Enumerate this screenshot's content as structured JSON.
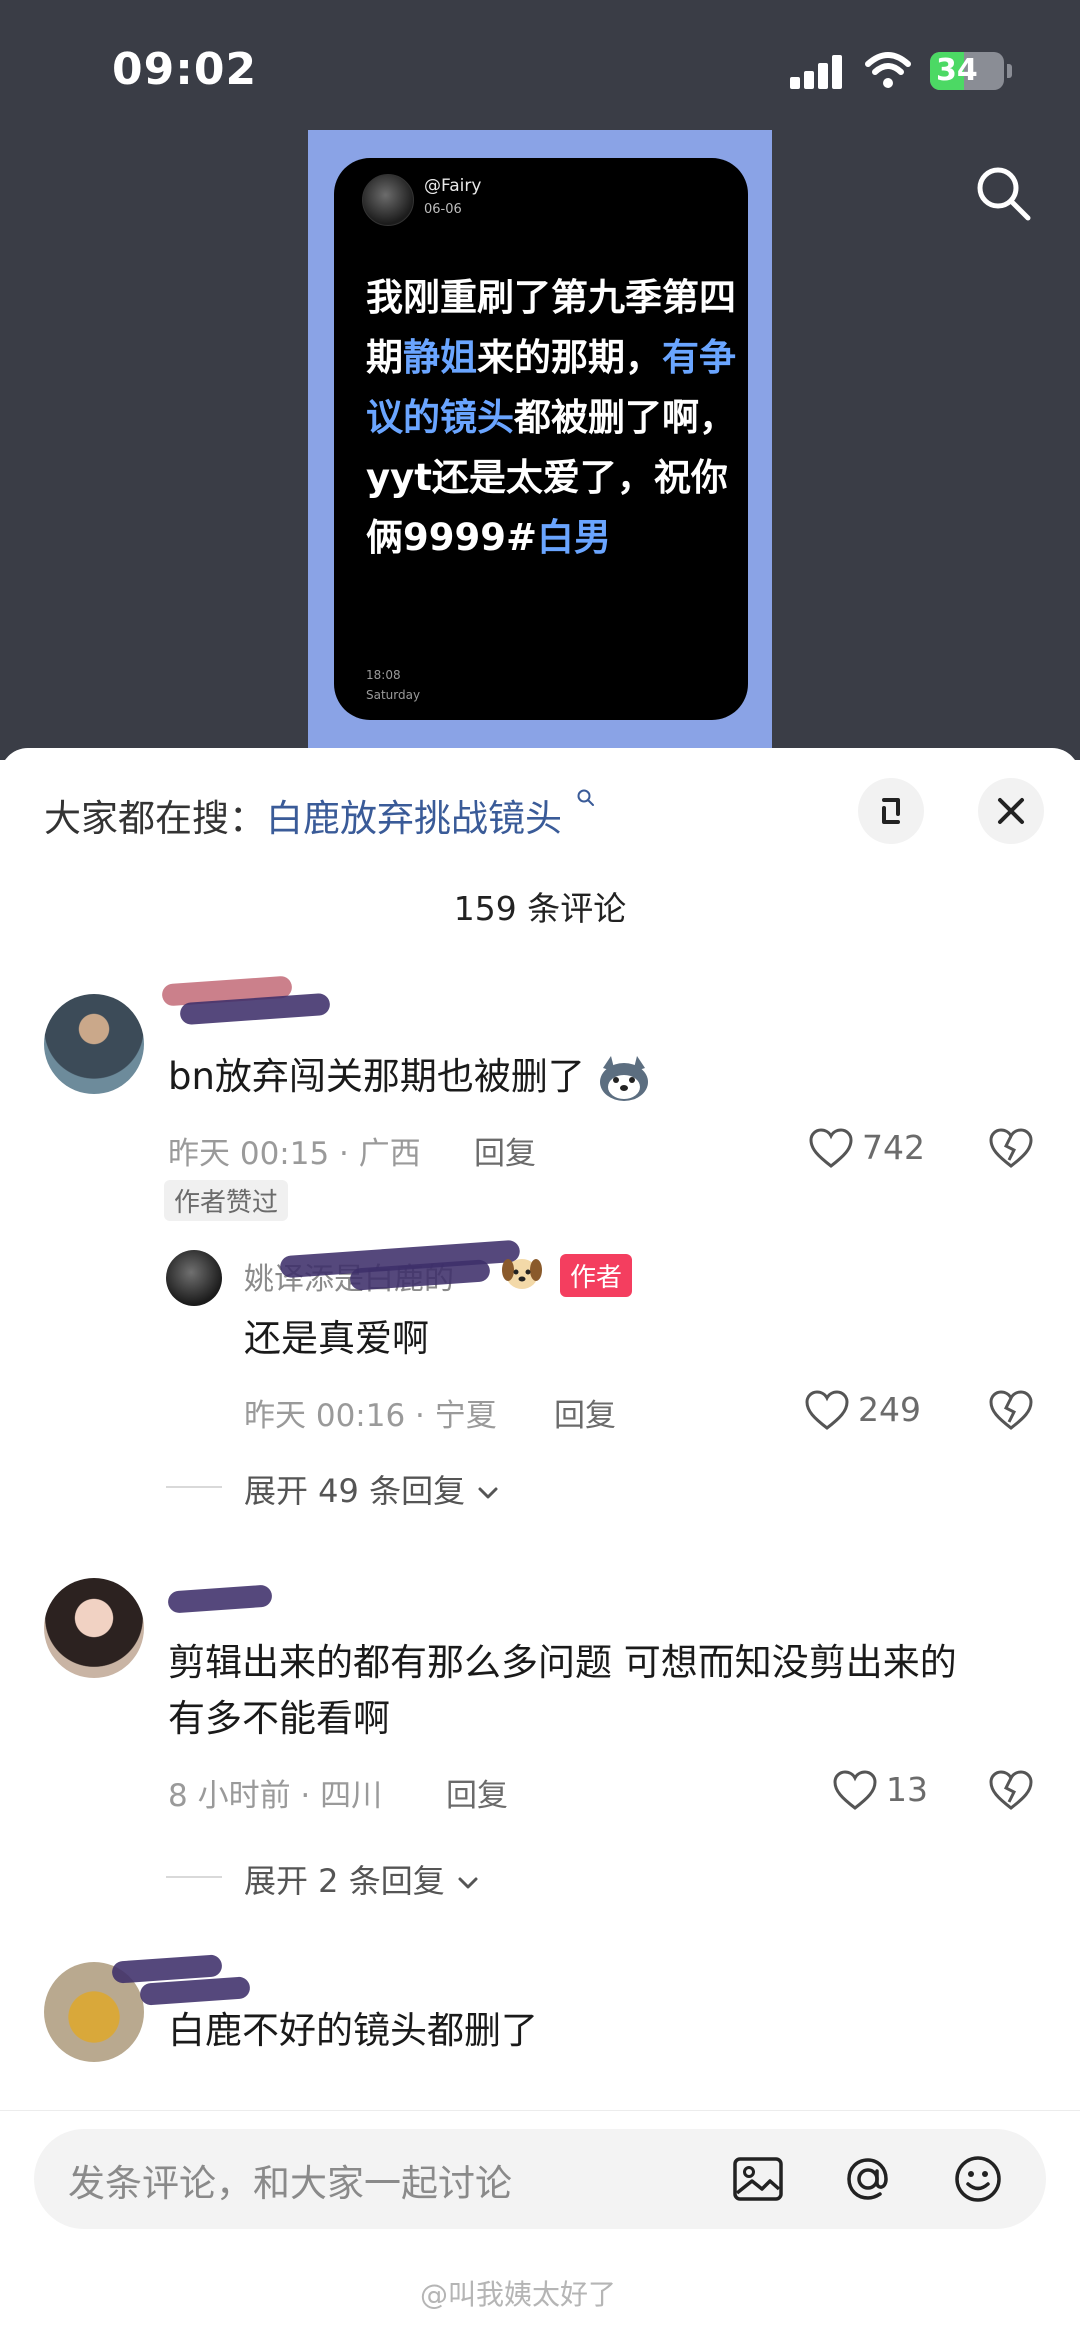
{
  "status": {
    "time": "09:02",
    "battery": "34"
  },
  "post_card": {
    "user": "@Fairy",
    "date": "06-06",
    "text_parts": [
      {
        "t": "我刚重刷了第九季第四期",
        "hl": false
      },
      {
        "t": "静姐",
        "hl": true
      },
      {
        "t": "来的那期，",
        "hl": false
      },
      {
        "t": "有争议的镜头",
        "hl": true
      },
      {
        "t": "都被删了啊，yyt还是太爱了，祝你俩9999#",
        "hl": false
      },
      {
        "t": "白男",
        "hl": true
      }
    ],
    "time": "18:08",
    "day": "Saturday"
  },
  "sheet": {
    "hot_search_label": "大家都在搜：",
    "hot_search_query": "白鹿放弃挑战镜头",
    "comment_count": "159 条评论"
  },
  "comments": {
    "c1": {
      "text": "bn放弃闯关那期也被删了",
      "meta": "昨天 00:15 · 广西",
      "reply": "回复",
      "likes": "742",
      "badge": "作者赞过"
    },
    "r1": {
      "username": "姚译添是白鹿的",
      "author_tag": "作者",
      "text": "还是真爱啊",
      "meta": "昨天 00:16 · 宁夏",
      "reply": "回复",
      "likes": "249"
    },
    "expand1": "展开 49 条回复",
    "c2": {
      "text_line1": "剪辑出来的都有那么多问题 可想而知没剪出来的",
      "text_line2": "有多不能看啊",
      "meta": "8 小时前 · 四川",
      "reply": "回复",
      "likes": "13"
    },
    "expand2": "展开 2 条回复",
    "c3": {
      "text": "白鹿不好的镜头都删了"
    }
  },
  "input": {
    "placeholder": "发条评论，和大家一起讨论"
  },
  "watermark": "@叫我姨太好了",
  "colors": {
    "accent_red": "#f43e5f",
    "link_blue": "#3a5b98",
    "poster_bg": "#8aa3e6"
  }
}
